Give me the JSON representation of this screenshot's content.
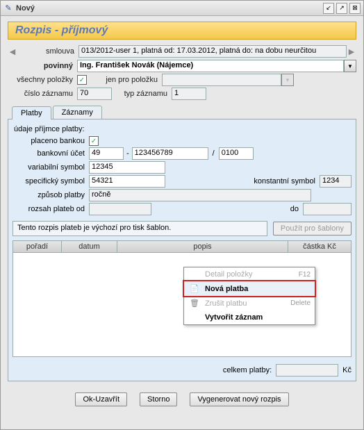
{
  "window": {
    "title": "Nový"
  },
  "header": {
    "title": "Rozpis - příjmový"
  },
  "top": {
    "smlouva_label": "smlouva",
    "smlouva_value": "013/2012-user 1, platná od: 17.03.2012, platná do: na dobu neurčitou",
    "povinny_label": "povinný",
    "povinny_value": "Ing. František Novák (Nájemce)",
    "vsechny_label": "všechny položky",
    "vsechny_checked": "✓",
    "jenpro_label": "jen pro položku",
    "jenpro_value": "",
    "cislo_label": "číslo záznamu",
    "cislo_value": "70",
    "typ_label": "typ záznamu",
    "typ_value": "1"
  },
  "tabs": {
    "platby": "Platby",
    "zaznamy": "Záznamy"
  },
  "pay": {
    "udaje": "údaje příjmce platby:",
    "placeno_label": "placeno bankou",
    "placeno_checked": "✓",
    "ucet_label": "bankovní účet",
    "ucet_pred": "49",
    "ucet_dash": "-",
    "ucet_num": "123456789",
    "ucet_slash": "/",
    "ucet_bank": "0100",
    "vs_label": "variabilní symbol",
    "vs_value": "12345",
    "ss_label": "specifický symbol",
    "ss_value": "54321",
    "ks_label": "konstantní symbol",
    "ks_value": "1234",
    "zpusob_label": "způsob platby",
    "zpusob_value": "ročně",
    "rozsah_label": "rozsah plateb od",
    "rozsah_od": "",
    "do_label": "do",
    "rozsah_do": "",
    "template_text": "Tento rozpis plateb je výchozí pro tisk šablon.",
    "template_btn": "Použít pro šablony"
  },
  "grid": {
    "h_poradi": "pořadí",
    "h_datum": "datum",
    "h_popis": "popis",
    "h_castka": "částka Kč"
  },
  "ctx": {
    "detail": "Detail položky",
    "detail_sc": "F12",
    "nova": "Nová platba",
    "zrusit": "Zrušit platbu",
    "zrusit_sc": "Delete",
    "vytvorit": "Vytvořit záznam"
  },
  "total": {
    "label": "celkem platby:",
    "value": "",
    "unit": "Kč"
  },
  "footer": {
    "ok": "Ok-Uzavřít",
    "storno": "Storno",
    "vygen": "Vygenerovat nový rozpis"
  }
}
